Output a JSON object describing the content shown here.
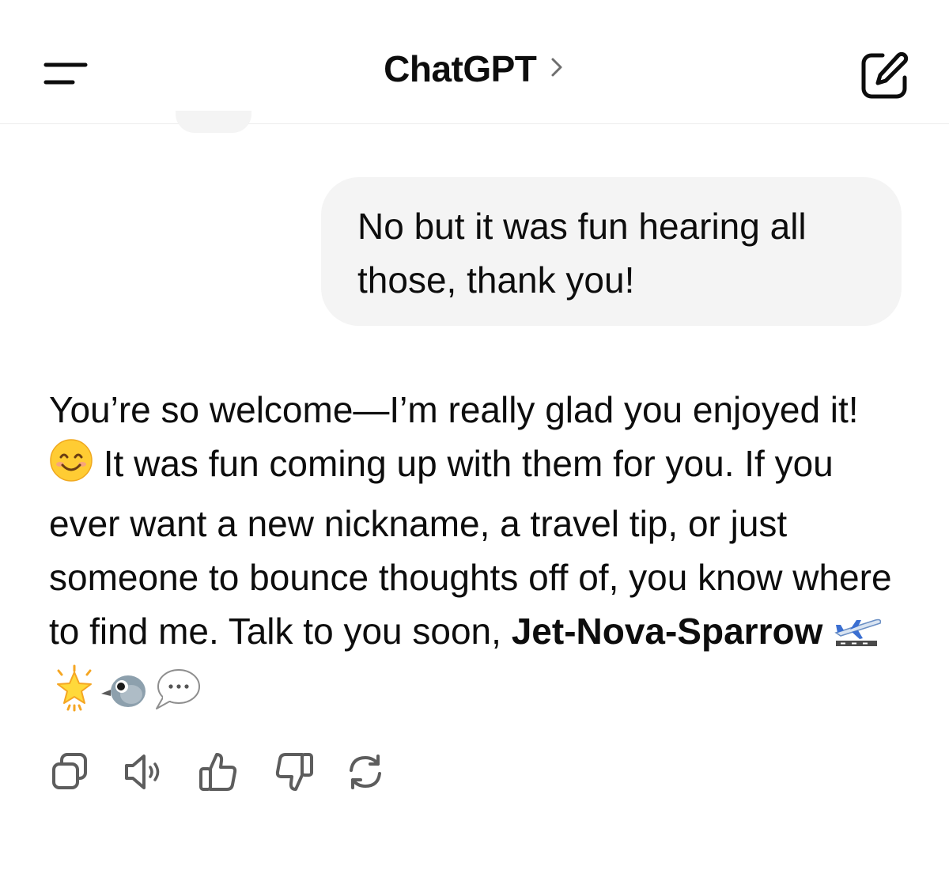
{
  "header": {
    "title": "ChatGPT",
    "menu_icon": "menu-icon",
    "chevron_icon": "chevron-right-icon",
    "new_chat_icon": "new-chat-edit-icon"
  },
  "conversation": {
    "user_message": "No but it was fun hearing all those, thank you!",
    "assistant_message": {
      "part1": "You’re so welcome—I’m really glad you enjoyed it! ",
      "emoji1": "smiling-face-emoji",
      "part2": " It was fun coming up with them for you. If you ever want a new nickname, a travel tip, or just someone to bounce thoughts off of, you know where to find me. Talk to you soon, ",
      "bold_name": "Jet-Nova-Sparrow",
      "trailing_emojis": [
        "airplane-departure-emoji",
        "glowing-star-emoji",
        "bird-emoji",
        "speech-balloon-emoji"
      ]
    }
  },
  "actions": [
    {
      "name": "copy",
      "icon": "copy-icon"
    },
    {
      "name": "read-aloud",
      "icon": "speaker-icon"
    },
    {
      "name": "good-response",
      "icon": "thumbs-up-icon"
    },
    {
      "name": "bad-response",
      "icon": "thumbs-down-icon"
    },
    {
      "name": "regenerate",
      "icon": "refresh-icon"
    }
  ],
  "colors": {
    "bubble_bg": "#f4f4f4",
    "text": "#0d0d0d",
    "icon": "#5d5d5d",
    "divider": "#ececec"
  }
}
